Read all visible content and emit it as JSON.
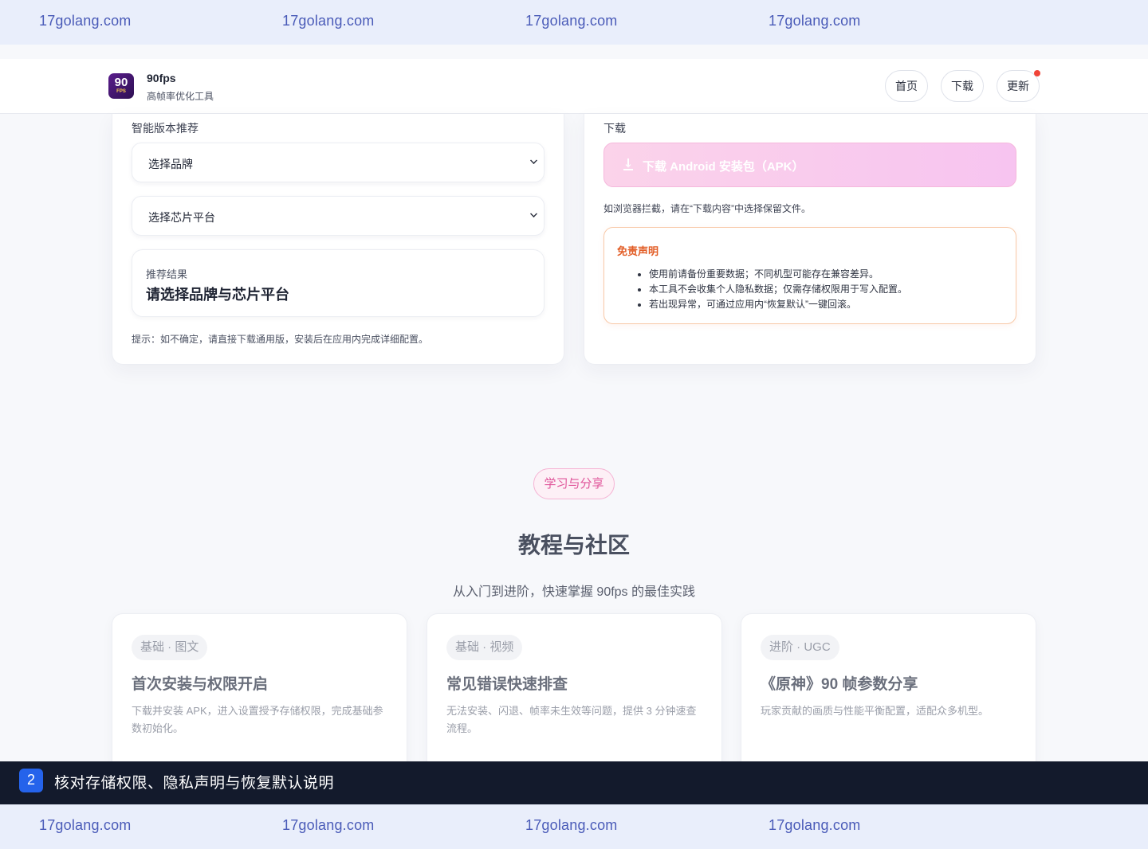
{
  "watermark": {
    "text": "17golang.com"
  },
  "header": {
    "logo_top": "90",
    "logo_bottom": "FPS",
    "brand_name": "90fps",
    "brand_sub": "高帧率优化工具",
    "nav": [
      "首页",
      "下载",
      "更新"
    ]
  },
  "recommend": {
    "section_label": "智能版本推荐",
    "brand_select": "选择品牌",
    "chip_select": "选择芯片平台",
    "result_label": "推荐结果",
    "result_value": "请选择品牌与芯片平台",
    "hint": "提示：如不确定，请直接下载通用版，安装后在应用内完成详细配置。"
  },
  "download": {
    "section_label": "下载",
    "button_label": "下载 Android 安装包（APK）",
    "note": "如浏览器拦截，请在“下载内容”中选择保留文件。",
    "disclaimer_title": "免责声明",
    "disclaimer_items": [
      "使用前请备份重要数据；不同机型可能存在兼容差异。",
      "本工具不会收集个人隐私数据；仅需存储权限用于写入配置。",
      "若出现异常，可通过应用内“恢复默认”一键回滚。"
    ]
  },
  "tutorials": {
    "pill": "学习与分享",
    "title": "教程与社区",
    "subtitle": "从入门到进阶，快速掌握 90fps 的最佳实践",
    "cards": [
      {
        "tag": "基础 · 图文",
        "title": "首次安装与权限开启",
        "desc": "下载并安装 APK，进入设置授予存储权限，完成基础参数初始化。"
      },
      {
        "tag": "基础 · 视频",
        "title": "常见错误快速排查",
        "desc": "无法安装、闪退、帧率未生效等问题，提供 3 分钟速查流程。"
      },
      {
        "tag": "进阶 · UGC",
        "title": "《原神》90 帧参数分享",
        "desc": "玩家贡献的画质与性能平衡配置，适配众多机型。"
      }
    ]
  },
  "banner": {
    "step": "2",
    "text": "核对存储权限、隐私声明与恢复默认说明"
  },
  "colors": {
    "accent_pink": "#e0559a",
    "warning_orange": "#e25d26",
    "banner_bg": "#131a2c",
    "step_blue": "#2563eb",
    "watermark_blue": "#4a5bb8"
  }
}
